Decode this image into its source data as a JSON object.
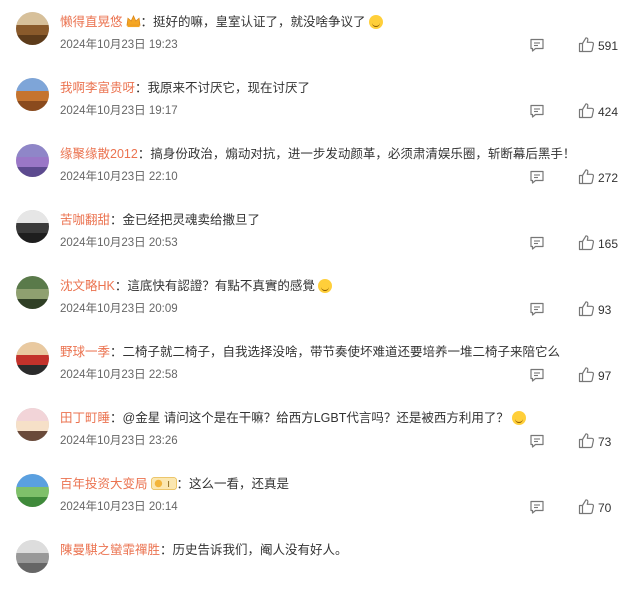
{
  "comments": [
    {
      "username": "懒得直晃悠",
      "text": "挺好的嘛，皇室认证了，就没啥争议了",
      "time": "2024年10月23日 19:23",
      "likes": "591",
      "badge": "crown-badge",
      "emoji": "laugh-emoji",
      "avatar_colors": [
        "#d7c09a",
        "#8a5a2b",
        "#5d3b1a"
      ]
    },
    {
      "username": "我啊李富贵呀",
      "text": "我原来不讨厌它，现在讨厌了",
      "time": "2024年10月23日 19:17",
      "likes": "424",
      "avatar_colors": [
        "#7ea5d8",
        "#c5742f",
        "#8a4a1d"
      ]
    },
    {
      "username": "缘聚缘散2012",
      "text": "搞身份政治，煽动对抗，进一步发动颜革，必须肃清娱乐圈，斩断幕后黑手！",
      "time": "2024年10月23日 22:10",
      "likes": "272",
      "avatar_colors": [
        "#8f86c8",
        "#9a77c7",
        "#5c4a8f"
      ]
    },
    {
      "username": "苦咖翻甜",
      "text": "金已经把灵魂卖给撒旦了",
      "time": "2024年10月23日 20:53",
      "likes": "165",
      "avatar_colors": [
        "#e6e6e6",
        "#3a3a3a",
        "#1e1e1e"
      ]
    },
    {
      "username": "沈文略HK",
      "text": "這底快有認證？有點不真實的感覺",
      "time": "2024年10月23日 20:09",
      "likes": "93",
      "emoji": "laugh-emoji",
      "avatar_colors": [
        "#5a7a4a",
        "#8fa070",
        "#2f3f25"
      ]
    },
    {
      "username": "野球一季",
      "text": "二椅子就二椅子，自我选择没啥，带节奏使坏难道还要培养一堆二椅子来陪它么",
      "time": "2024年10月23日 22:58",
      "likes": "97",
      "avatar_colors": [
        "#e9c9a0",
        "#c3322b",
        "#2b2b2b"
      ]
    },
    {
      "username": "田丁町睡",
      "text": "@金星 请问这个是在干嘛？给西方LGBT代言吗？还是被西方利用了？",
      "time": "2024年10月23日 23:26",
      "likes": "73",
      "emoji": "thinking-emoji",
      "avatar_colors": [
        "#f2d4d8",
        "#f6e0c8",
        "#6a4a3a"
      ]
    },
    {
      "username": "百年投资大变局",
      "text": "这么一看，还真是",
      "time": "2024年10月23日 20:14",
      "likes": "70",
      "badge": "level-badge",
      "avatar_colors": [
        "#5aa0e0",
        "#7fc06a",
        "#3f8a3a"
      ]
    },
    {
      "username": "陳曼騏之蠻霏禪胜",
      "text": "历史告诉我们，阉人没有好人。",
      "time": "",
      "likes": "",
      "avatar_colors": [
        "#dddddd",
        "#999999",
        "#666666"
      ]
    }
  ],
  "colors": {
    "username": "#eb7350",
    "text": "#333333",
    "meta": "#666666",
    "icon": "#777777"
  },
  "icons": {
    "reply": "reply-icon",
    "like": "thumbs-up-icon"
  }
}
